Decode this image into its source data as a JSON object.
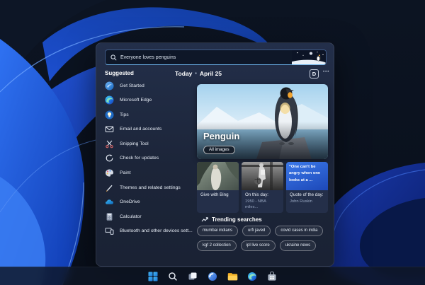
{
  "search": {
    "value": "Everyone loves penguins",
    "icon": "search-icon",
    "decoration": "penguin-night-art"
  },
  "suggested": {
    "header": "Suggested",
    "items": [
      {
        "label": "Get Started",
        "icon": "get-started-icon"
      },
      {
        "label": "Microsoft Edge",
        "icon": "edge-icon"
      },
      {
        "label": "Tips",
        "icon": "tips-icon"
      },
      {
        "label": "Email and accounts",
        "icon": "email-icon"
      },
      {
        "label": "Snipping Tool",
        "icon": "snipping-tool-icon"
      },
      {
        "label": "Check for updates",
        "icon": "update-icon"
      },
      {
        "label": "Paint",
        "icon": "paint-icon"
      },
      {
        "label": "Themes and related settings",
        "icon": "themes-icon"
      },
      {
        "label": "OneDrive",
        "icon": "onedrive-icon"
      },
      {
        "label": "Calculator",
        "icon": "calculator-icon"
      },
      {
        "label": "Bluetooth and other devices sett...",
        "icon": "bluetooth-devices-icon"
      }
    ]
  },
  "today": {
    "label": "Today",
    "separator": "•",
    "date": "April 25",
    "profile_badge": "D",
    "more_label": "•••"
  },
  "hero": {
    "title": "Penguin",
    "button_label": "All images"
  },
  "cards": [
    {
      "title": "Give with Bing"
    },
    {
      "title": "On this day:",
      "subtitle": "1950 - NBA miles..."
    },
    {
      "title": "Quote of the day:",
      "subtitle": "John Ruskin",
      "quote": "“One can't be angry when one looks at a ..."
    }
  ],
  "trending": {
    "header": "Trending searches",
    "icon": "trending-icon",
    "pills": [
      "mumbai indians",
      "urfi javed",
      "covid cases in india",
      "kgf 2 collection",
      "ipl live score",
      "ukraine news"
    ]
  },
  "taskbar": {
    "icons": [
      "start",
      "search",
      "task-view",
      "widgets",
      "file-explorer",
      "edge",
      "store"
    ]
  },
  "colors": {
    "panel_bg": "#1d2840",
    "accent": "#6ab0e8",
    "bloom_blue": "#2a6af0",
    "quote_card": "#2b63d8"
  }
}
